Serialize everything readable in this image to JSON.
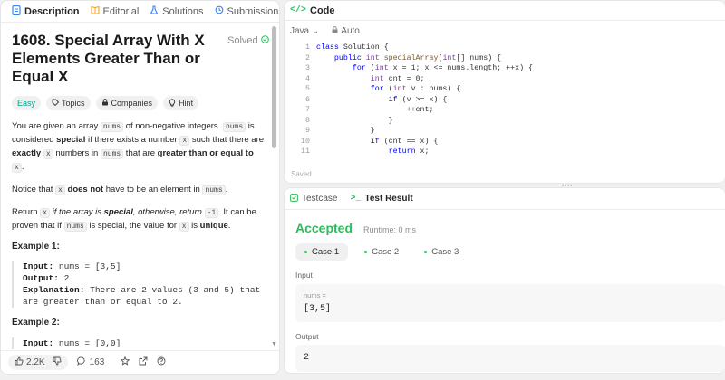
{
  "left": {
    "tabs": [
      {
        "label": "Description",
        "icon": "document-icon"
      },
      {
        "label": "Editorial",
        "icon": "book-icon"
      },
      {
        "label": "Solutions",
        "icon": "flask-icon"
      },
      {
        "label": "Submissions",
        "icon": "history-icon"
      }
    ],
    "title": "1608. Special Array With X Elements Greater Than or Equal X",
    "solved_label": "Solved",
    "tags": [
      "Easy",
      "Topics",
      "Companies",
      "Hint"
    ],
    "desc": {
      "p1_a": "You are given an array ",
      "p1_code1": "nums",
      "p1_b": " of non-negative integers. ",
      "p1_code2": "nums",
      "p1_c": " is considered ",
      "p1_bold1": "special",
      "p1_d": " if there exists a number ",
      "p1_code3": "x",
      "p1_e": " such that there are ",
      "p1_bold2": "exactly",
      "p1_code4": "x",
      "p1_f": " numbers in ",
      "p1_code5": "nums",
      "p1_g": " that are ",
      "p1_bold3": "greater than or equal to",
      "p1_code6": "x",
      "p1_h": ".",
      "p2_a": "Notice that ",
      "p2_code1": "x",
      "p2_bold": "does not",
      "p2_b": " have to be an element in ",
      "p2_code2": "nums",
      "p2_c": ".",
      "p3_a": "Return ",
      "p3_code1": "x",
      "p3_it": " if the array is ",
      "p3_itb": "special",
      "p3_it2": ", otherwise, return ",
      "p3_code2": "-1",
      "p3_b": ". It can be proven that if ",
      "p3_code3": "nums",
      "p3_c": " is special, the value for ",
      "p3_code4": "x",
      "p3_d": " is ",
      "p3_bold": "unique",
      "p3_e": "."
    },
    "example1": {
      "title": "Example 1:",
      "input_label": "Input:",
      "input": "nums = [3,5]",
      "output_label": "Output:",
      "output": "2",
      "explanation_label": "Explanation:",
      "explanation": "There are 2 values (3 and 5) that are greater than or equal to 2."
    },
    "example2": {
      "title": "Example 2:",
      "input_label": "Input:",
      "input": "nums = [0,0]"
    },
    "likes": "2.2K",
    "comments": "163"
  },
  "code": {
    "header": "Code",
    "language": "Java",
    "auto_label": "Auto",
    "saved_label": "Saved",
    "lines": [
      {
        "n": "1",
        "t": "class Solution {"
      },
      {
        "n": "2",
        "t": "    public int specialArray(int[] nums) {"
      },
      {
        "n": "3",
        "t": "        for (int x = 1; x <= nums.length; ++x) {"
      },
      {
        "n": "4",
        "t": "            int cnt = 0;"
      },
      {
        "n": "5",
        "t": "            for (int v : nums) {"
      },
      {
        "n": "6",
        "t": "                if (v >= x) {"
      },
      {
        "n": "7",
        "t": "                    ++cnt;"
      },
      {
        "n": "8",
        "t": "                }"
      },
      {
        "n": "9",
        "t": "            }"
      },
      {
        "n": "10",
        "t": "            if (cnt == x) {"
      },
      {
        "n": "11",
        "t": "                return x;"
      }
    ]
  },
  "test": {
    "tabs": [
      "Testcase",
      "Test Result"
    ],
    "status": "Accepted",
    "runtime": "Runtime: 0 ms",
    "cases": [
      "Case 1",
      "Case 2",
      "Case 3"
    ],
    "input_label": "Input",
    "var_name": "nums =",
    "var_value": "[3,5]",
    "output_label": "Output",
    "output_value": "2"
  },
  "colors": {
    "accent_green": "#2cbb5d",
    "easy": "#00a38a"
  }
}
